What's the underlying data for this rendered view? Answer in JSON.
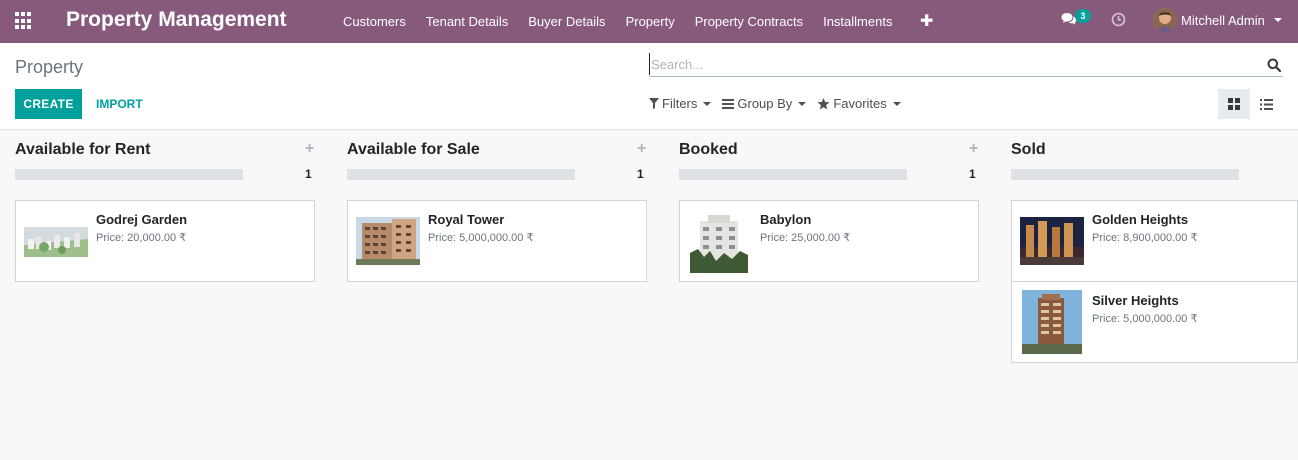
{
  "navbar": {
    "app_title": "Property Management",
    "menu": [
      "Customers",
      "Tenant Details",
      "Buyer Details",
      "Property",
      "Property Contracts",
      "Installments"
    ],
    "messages_count": "3",
    "user_name": "Mitchell Admin",
    "background_color": "#875a7b"
  },
  "control_panel": {
    "breadcrumb": "Property",
    "create_label": "CREATE",
    "import_label": "IMPORT",
    "search_placeholder": "Search...",
    "filters_label": "Filters",
    "group_by_label": "Group By",
    "favorites_label": "Favorites",
    "active_view": "kanban",
    "accent_color": "#00a09d"
  },
  "kanban": {
    "columns": [
      {
        "title": "Available for Rent",
        "count": "1",
        "cards": [
          {
            "name": "Godrej Garden",
            "price": "Price: 20,000.00 ₹",
            "image": "township-aerial"
          }
        ]
      },
      {
        "title": "Available for Sale",
        "count": "1",
        "cards": [
          {
            "name": "Royal Tower",
            "price": "Price: 5,000,000.00 ₹",
            "image": "apartment-building"
          }
        ]
      },
      {
        "title": "Booked",
        "count": "1",
        "cards": [
          {
            "name": "Babylon",
            "price": "Price: 25,000.00 ₹",
            "image": "white-tower"
          }
        ]
      },
      {
        "title": "Sold",
        "count": "",
        "cards": [
          {
            "name": "Golden Heights",
            "price": "Price: 8,900,000.00 ₹",
            "image": "night-skyscrapers"
          },
          {
            "name": "Silver Heights",
            "price": "Price: 5,000,000.00 ₹",
            "image": "modern-tower"
          }
        ]
      }
    ]
  }
}
